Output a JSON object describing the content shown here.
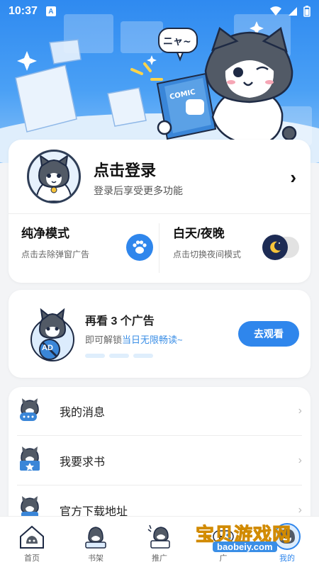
{
  "status_bar": {
    "time": "10:37",
    "notification_icon": "a-icon",
    "icons": [
      "wifi-icon",
      "signal-icon",
      "battery-icon"
    ]
  },
  "hero": {
    "speech_bubble": "ニャ~",
    "book_label": "COMIC"
  },
  "login": {
    "title": "点击登录",
    "subtitle": "登录后享受更多功能",
    "chevron": "›"
  },
  "modes": {
    "pure": {
      "title": "纯净模式",
      "subtitle": "点击去除弹窗广告"
    },
    "day_night": {
      "title": "白天/夜晚",
      "subtitle": "点击切换夜间模式"
    }
  },
  "ad_unlock": {
    "title": "再看 3 个广告",
    "subtitle_prefix": "即可解锁",
    "subtitle_highlight": "当日无限畅读~",
    "button": "去观看",
    "badge": "AD",
    "progress_done": 0,
    "progress_total": 3
  },
  "menu": {
    "items": [
      {
        "label": "我的消息",
        "icon": "cat-message-icon"
      },
      {
        "label": "我要求书",
        "icon": "cat-book-icon"
      },
      {
        "label": "官方下载地址",
        "icon": "cat-download-icon"
      }
    ]
  },
  "tabs": [
    {
      "label": "首页",
      "icon": "home-icon"
    },
    {
      "label": "书架",
      "icon": "bookshelf-icon"
    },
    {
      "label": "推广",
      "icon": "promote-icon"
    },
    {
      "label": "广",
      "icon": "game-icon"
    },
    {
      "label": "我的",
      "icon": "profile-icon"
    }
  ],
  "watermark": {
    "cn": "宝贝游戏网",
    "en": "baobeiy.com"
  },
  "colors": {
    "primary": "#2f86ec",
    "hero_top": "#2f8af0",
    "background": "#f3f4f6",
    "watermark_yellow": "#f7b91e"
  }
}
